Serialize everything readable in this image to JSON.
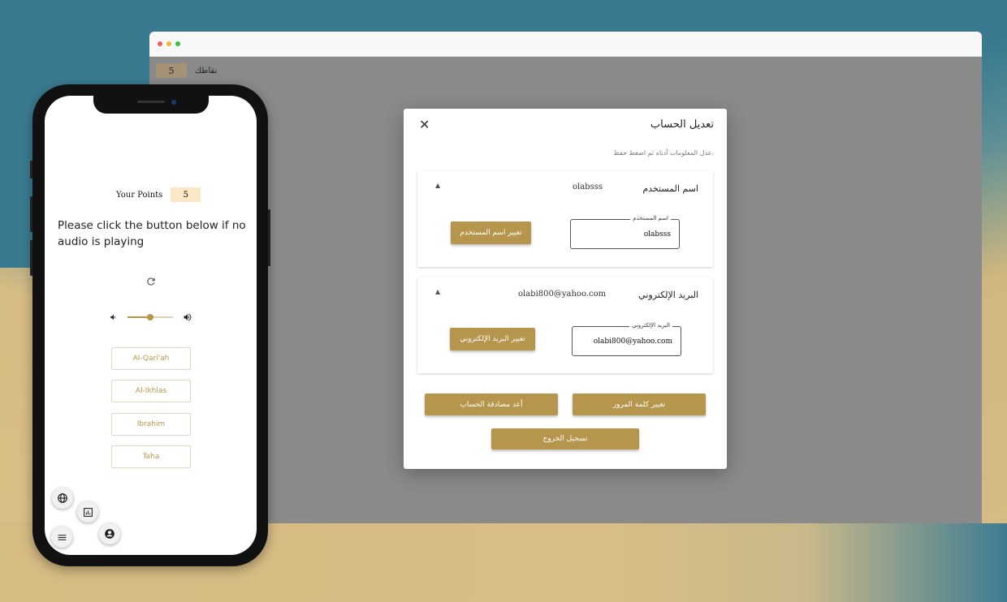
{
  "browser": {
    "points_value": "5",
    "points_label": "نقاطك"
  },
  "modal": {
    "title": "تعديل الحساب",
    "hint": "عدل المعلومات أدناه ثم اضغط حفظ.",
    "close_glyph": "✕",
    "username_section": {
      "title": "اسم المستخدم",
      "value": "olabsss",
      "field_label": "اسم المستخدم",
      "field_value": "olabsss",
      "button": "تغيير اسم المستخدم"
    },
    "email_section": {
      "title": "البريد الإلكتروني",
      "value": "olabi800@yahoo.com",
      "field_label": "البريد الإلكتروني",
      "field_value": "olabi800@yahoo.com",
      "button": "تغيير البريد الإلكتروني"
    },
    "reauth_button": "أعد مصادقة الحساب",
    "password_button": "تغيير كلمة المرور",
    "logout_button": "تسجيل الخروج"
  },
  "phone": {
    "points_label": "Your Points",
    "points_value": "5",
    "instruction": "Please click the button below if no audio is playing",
    "volume_level": 0.5,
    "choices": [
      "Al-Qari'ah",
      "Al-Ikhlas",
      "Ibrahim",
      "Taha"
    ],
    "icons": [
      "refresh-icon",
      "volume-down-icon",
      "volume-up-icon",
      "globe-icon",
      "chart-icon",
      "menu-icon",
      "account-icon"
    ]
  },
  "colors": {
    "accent": "#b6964c",
    "points_bg": "#fbe6c6",
    "overlay": "#8a8a8a"
  }
}
